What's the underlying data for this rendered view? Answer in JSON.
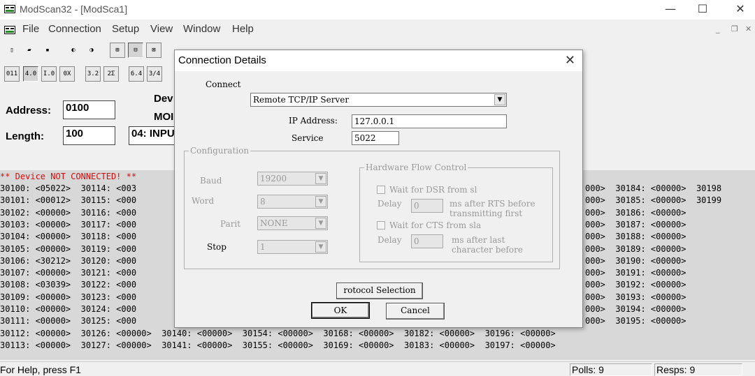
{
  "window": {
    "title": "ModScan32 - [ModSca1]"
  },
  "menu": [
    "File",
    "Connection",
    "Setup",
    "View",
    "Window",
    "Help"
  ],
  "toolbar1": [
    {
      "icon": "new-file-icon",
      "glyph": "▯"
    },
    {
      "icon": "open-folder-icon",
      "glyph": "▰"
    },
    {
      "icon": "save-icon",
      "glyph": "▪"
    },
    {
      "icon": "connect-icon",
      "glyph": "◐"
    },
    {
      "icon": "disconnect-icon",
      "glyph": "◑"
    },
    {
      "icon": "network-icon",
      "glyph": "⊞"
    },
    {
      "icon": "network-node-icon",
      "glyph": "⊟"
    },
    {
      "icon": "network-search-icon",
      "glyph": "⊠"
    },
    {
      "icon": "print-icon",
      "glyph": "⎙"
    },
    {
      "icon": "help-icon",
      "glyph": "?"
    },
    {
      "icon": "context-help-icon",
      "glyph": "✎"
    }
  ],
  "toolbar2": [
    "011",
    "4.0",
    "I.0",
    "0X",
    "3.2",
    "2Σ",
    "6.4",
    "3∕4"
  ],
  "form": {
    "address_label": "Address:",
    "address_value": "0100",
    "length_label": "Length:",
    "length_value": "100",
    "device_label": "Dev",
    "modbus_label": "MOI",
    "point_type": "04: INPU"
  },
  "registers": {
    "status": "** Device NOT CONNECTED! **",
    "rows": [
      "30100: <05022>  30114: <003",
      "30101: <00012>  30115: <000",
      "30102: <00000>  30116: <000",
      "30103: <00000>  30117: <000",
      "30104: <00000>  30118: <000",
      "30105: <00000>  30119: <000",
      "30106: <30212>  30120: <000",
      "30107: <00000>  30121: <000",
      "30108: <03039>  30122: <000",
      "30109: <00000>  30123: <000",
      "30110: <00000>  30124: <000",
      "30111: <00000>  30125: <000",
      "30112: <00000>  30126: <00000>  30140: <00000>  30154: <00000>  30168: <00000>  30182: <00000>  30196: <00000>",
      "30113: <00000>  30127: <00000>  30141: <00000>  30155: <00000>  30169: <00000>  30183: <00000>  30197: <00000>"
    ],
    "right_rows": [
      "000>  30184: <00000>  30198",
      "000>  30185: <00000>  30199",
      "000>  30186: <00000>",
      "000>  30187: <00000>",
      "000>  30188: <00000>",
      "000>  30189: <00000>",
      "000>  30190: <00000>",
      "000>  30191: <00000>",
      "000>  30192: <00000>",
      "000>  30193: <00000>",
      "000>  30194: <00000>",
      "000>  30195: <00000>"
    ]
  },
  "status": {
    "help": "For Help, press F1",
    "polls": "Polls: 9",
    "resps": "Resps: 9"
  },
  "dialog": {
    "title": "Connection Details",
    "connect_label": "Connect",
    "connect_value": "Remote TCP/IP Server",
    "ip_label": "IP Address:",
    "ip_value": "127.0.0.1",
    "service_label": "Service",
    "service_value": "5022",
    "config_label": "Configuration",
    "baud_label": "Baud",
    "baud_value": "19200",
    "word_label": "Word",
    "word_value": "8",
    "parity_label": "Parit",
    "parity_value": "NONE",
    "stop_label": "Stop",
    "stop_value": "1",
    "hw_label": "Hardware Flow Control",
    "dsr_label": "Wait for DSR from sl",
    "delay_label": "Delay",
    "delay1_value": "0",
    "rts_note_1": "ms after RTS before",
    "rts_note_2": "transmitting first",
    "cts_label": "Wait for CTS from sla",
    "delay2_value": "0",
    "last_note_1": "ms after last",
    "last_note_2": "character before",
    "protocol_button": "rotocol Selection",
    "ok_button": "OK",
    "cancel_button": "Cancel"
  }
}
